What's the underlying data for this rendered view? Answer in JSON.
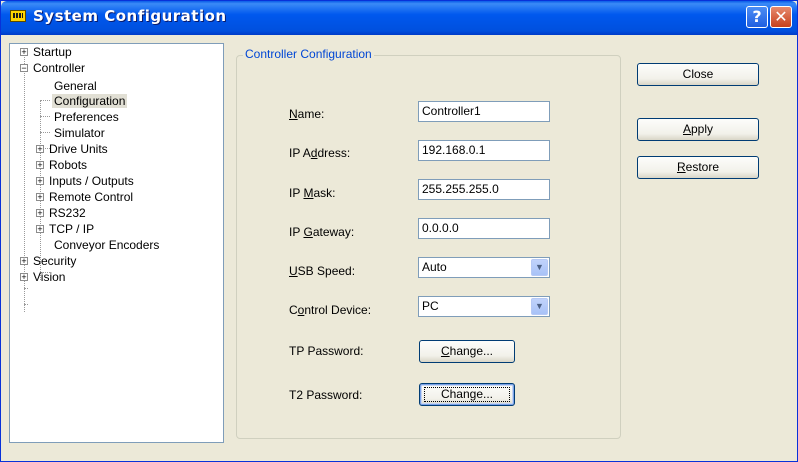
{
  "window": {
    "title": "System Configuration",
    "icon": "app-window-icon"
  },
  "title_buttons": {
    "help": "?",
    "close": "✕"
  },
  "tree": [
    {
      "label": "Startup",
      "expander": "+"
    },
    {
      "label": "Controller",
      "expander": "−"
    },
    {
      "label": "General"
    },
    {
      "label": "Configuration",
      "selected": true
    },
    {
      "label": "Preferences"
    },
    {
      "label": "Simulator"
    },
    {
      "label": "Drive Units",
      "expander": "+"
    },
    {
      "label": "Robots",
      "expander": "+"
    },
    {
      "label": "Inputs / Outputs",
      "expander": "+"
    },
    {
      "label": "Remote Control",
      "expander": "+"
    },
    {
      "label": "RS232",
      "expander": "+"
    },
    {
      "label": "TCP / IP",
      "expander": "+"
    },
    {
      "label": "Conveyor Encoders"
    },
    {
      "label": "Security",
      "expander": "+"
    },
    {
      "label": "Vision",
      "expander": "+"
    }
  ],
  "group_title": "Controller Configuration",
  "fields": {
    "name": {
      "label_pre": "",
      "label_key": "N",
      "label_post": "ame:",
      "value": "Controller1"
    },
    "ip_address": {
      "label_pre": "IP A",
      "label_key": "d",
      "label_post": "dress:",
      "value": "192.168.0.1"
    },
    "ip_mask": {
      "label_pre": "IP ",
      "label_key": "M",
      "label_post": "ask:",
      "value": "255.255.255.0"
    },
    "ip_gateway": {
      "label_pre": "IP ",
      "label_key": "G",
      "label_post": "ateway:",
      "value": "0.0.0.0"
    },
    "usb_speed": {
      "label_pre": "",
      "label_key": "U",
      "label_post": "SB Speed:",
      "value": "Auto"
    },
    "control_device": {
      "label_pre": "C",
      "label_key": "o",
      "label_post": "ntrol Device:",
      "value": "PC"
    },
    "tp_password": {
      "label": "TP Password:",
      "button_pre": "",
      "button_key": "C",
      "button_post": "hange..."
    },
    "t2_password": {
      "label": "T2 Password:",
      "button_pre": "Chan",
      "button_key": "g",
      "button_post": "e..."
    }
  },
  "buttons": {
    "close": {
      "pre": "Close",
      "key": "",
      "post": ""
    },
    "apply": {
      "pre": "",
      "key": "A",
      "post": "pply"
    },
    "restore": {
      "pre": "",
      "key": "R",
      "post": "estore"
    }
  },
  "colors": {
    "title_bar": "#0058ee",
    "group_title": "#0046d5",
    "dialog_bg": "#ece9d8"
  }
}
